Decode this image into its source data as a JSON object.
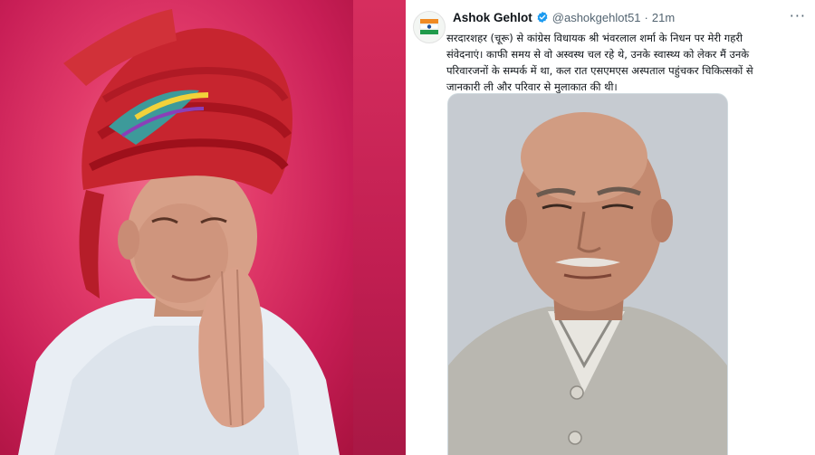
{
  "tweet": {
    "author_name": "Ashok Gehlot",
    "handle": "@ashokgehlot51",
    "separator": "·",
    "time": "21m",
    "more_menu": "···",
    "text_lines": [
      "सरदारशहर (चूरू) से कांग्रेस विधायक श्री भंवरलाल शर्मा के निधन पर मेरी गहरी",
      "संवेदनाएं। काफी समय से वो अस्वस्थ चल रहे थे, उनके स्वास्थ्य को लेकर मैं उनके",
      "परिवारजनों के सम्पर्क में था, कल रात एसएमएस अस्पताल पहुंचकर चिकित्सकों से",
      "जानकारी ली और परिवार से मुलाकात की थी।"
    ],
    "avatar_icon": "party-logo-icon",
    "verified_icon": "verified-badge-icon"
  },
  "colors": {
    "left_background": "#d62e5e",
    "verified_blue": "#1d9bf0",
    "text_primary": "#0f1419",
    "text_secondary": "#536471"
  }
}
